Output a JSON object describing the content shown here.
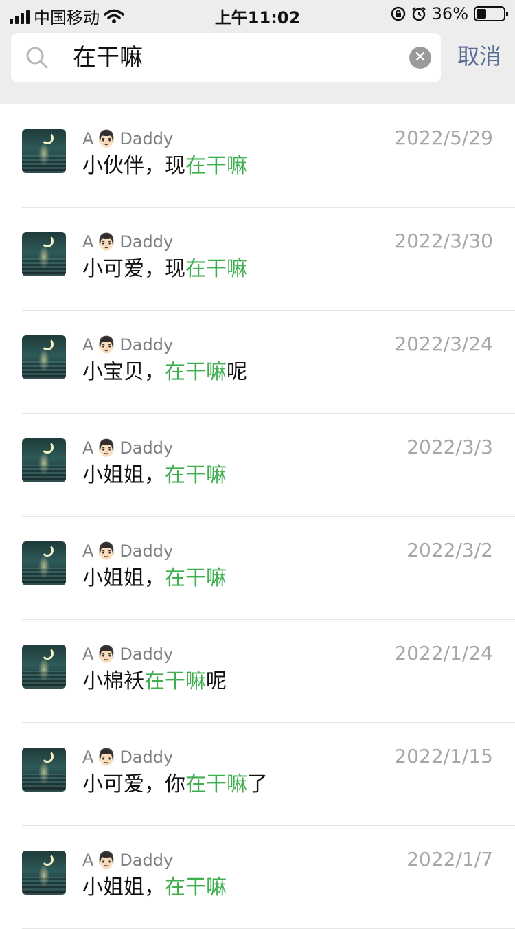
{
  "status_bar": {
    "carrier": "中国移动",
    "time": "上午11:02",
    "battery_percent": "36%",
    "battery_level": 0.36
  },
  "search": {
    "query": "在干嘛",
    "cancel_label": "取消",
    "search_icon": "search-icon",
    "clear_icon": "clear-icon"
  },
  "colors": {
    "highlight": "#3fae4f",
    "cancel": "#576b95",
    "date": "#a6a6a6"
  },
  "results": [
    {
      "sender_prefix": "A",
      "sender_emoji": "👨🏻",
      "sender_name": "Daddy",
      "date": "2022/5/29",
      "before": "小伙伴，现",
      "match": "在干嘛",
      "after": ""
    },
    {
      "sender_prefix": "A",
      "sender_emoji": "👨🏻",
      "sender_name": "Daddy",
      "date": "2022/3/30",
      "before": "小可爱，现",
      "match": "在干嘛",
      "after": ""
    },
    {
      "sender_prefix": "A",
      "sender_emoji": "👨🏻",
      "sender_name": "Daddy",
      "date": "2022/3/24",
      "before": "小宝贝，",
      "match": "在干嘛",
      "after": "呢"
    },
    {
      "sender_prefix": "A",
      "sender_emoji": "👨🏻",
      "sender_name": "Daddy",
      "date": "2022/3/3",
      "before": "小姐姐，",
      "match": "在干嘛",
      "after": ""
    },
    {
      "sender_prefix": "A",
      "sender_emoji": "👨🏻",
      "sender_name": "Daddy",
      "date": "2022/3/2",
      "before": "小姐姐，",
      "match": "在干嘛",
      "after": ""
    },
    {
      "sender_prefix": "A",
      "sender_emoji": "👨🏻",
      "sender_name": "Daddy",
      "date": "2022/1/24",
      "before": "小棉袄",
      "match": "在干嘛",
      "after": "呢"
    },
    {
      "sender_prefix": "A",
      "sender_emoji": "👨🏻",
      "sender_name": "Daddy",
      "date": "2022/1/15",
      "before": "小可爱，你",
      "match": "在干嘛",
      "after": "了"
    },
    {
      "sender_prefix": "A",
      "sender_emoji": "👨🏻",
      "sender_name": "Daddy",
      "date": "2022/1/7",
      "before": "小姐姐，",
      "match": "在干嘛",
      "after": ""
    }
  ]
}
